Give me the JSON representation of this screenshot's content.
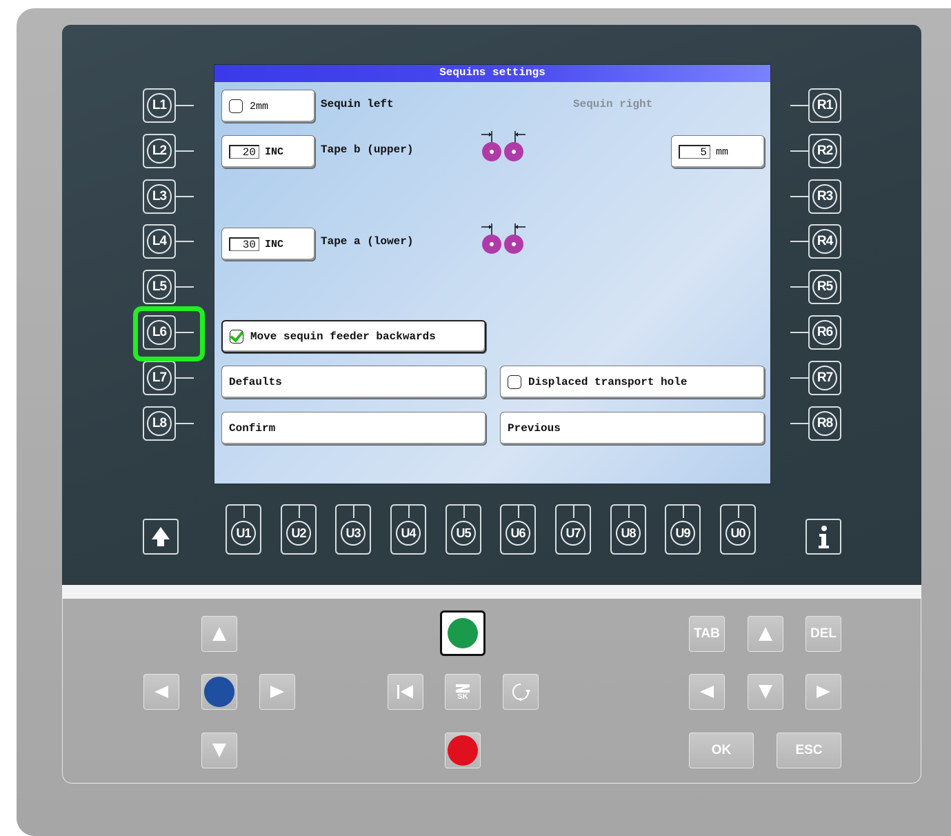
{
  "screen": {
    "title": "Sequins settings",
    "row1": {
      "checkbox_label": "2mm",
      "checked": false,
      "label_left": "Sequin left",
      "label_right": "Sequin right"
    },
    "row2": {
      "value": "20",
      "unit": "INC",
      "label": "Tape b (upper)",
      "right_value": "5",
      "right_unit": "mm"
    },
    "row4": {
      "value": "30",
      "unit": "INC",
      "label": "Tape a (lower)"
    },
    "row6": {
      "label": "Move sequin feeder backwards",
      "checked": true
    },
    "row7": {
      "left_label": "Defaults",
      "right_label": "Displaced transport hole",
      "right_checked": false
    },
    "row8": {
      "left_label": "Confirm",
      "right_label": "Previous"
    }
  },
  "left_keys": [
    "L1",
    "L2",
    "L3",
    "L4",
    "L5",
    "L6",
    "L7",
    "L8"
  ],
  "right_keys": [
    "R1",
    "R2",
    "R3",
    "R4",
    "R5",
    "R6",
    "R7",
    "R8"
  ],
  "u_keys": [
    "U1",
    "U2",
    "U3",
    "U4",
    "U5",
    "U6",
    "U7",
    "U8",
    "U9",
    "U0"
  ],
  "highlighted_key": "L6",
  "highlight_color": "#22ee22",
  "bottom_keys": {
    "tab": "TAB",
    "del": "DEL",
    "ok": "OK",
    "esc": "ESC",
    "logo": "SK"
  },
  "icons": {
    "up_arrow_dark": "up-arrow-icon",
    "info": "info-icon",
    "start": "green-start-icon",
    "stop": "red-stop-icon",
    "home": "blue-home-icon",
    "first": "skip-to-start-icon",
    "logo": "zsk-logo-icon",
    "rotate": "rotate-icon"
  },
  "colors": {
    "green_button": "#1a9a4a",
    "red_button": "#e0101e",
    "blue_button": "#1e4fa0",
    "sequin": "#b03aa8"
  }
}
